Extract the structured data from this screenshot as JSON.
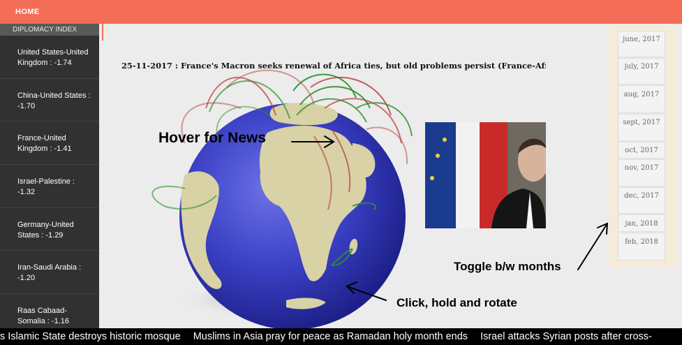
{
  "nav": {
    "home_label": "HOME"
  },
  "sidebar": {
    "title": "DIPLOMACY INDEX",
    "items": [
      {
        "label": "United States-United Kingdom : -1.74"
      },
      {
        "label": "China-United States : -1.70"
      },
      {
        "label": "France-United Kingdom : -1.41"
      },
      {
        "label": "Israel-Palestine : -1.32"
      },
      {
        "label": "Germany-United States : -1.29"
      },
      {
        "label": "Iran-Saudi Arabia : -1.20"
      },
      {
        "label": "Raas Cabaad-Somalia : -1.16"
      }
    ]
  },
  "news": {
    "headline": "25-11-2017 : France's Macron seeks renewal of Africa ties, but old problems persist (France-Afri"
  },
  "months": [
    {
      "label": "june, 2017"
    },
    {
      "label": "july, 2017"
    },
    {
      "label": "aug, 2017"
    },
    {
      "label": "sept, 2017"
    },
    {
      "label": "oct, 2017"
    },
    {
      "label": "nov, 2017"
    },
    {
      "label": "dec, 2017"
    },
    {
      "label": "jan, 2018"
    },
    {
      "label": "feb, 2018"
    }
  ],
  "annotations": {
    "hover": "Hover for News",
    "toggle": "Toggle b/w months",
    "rotate": "Click, hold and rotate"
  },
  "ticker": {
    "items": [
      "s Islamic State destroys historic mosque",
      "Muslims in Asia pray for peace as Ramadan holy month ends",
      "Israel attacks Syrian posts after cross-"
    ]
  },
  "colors": {
    "accent": "#f26c56",
    "sidebar_bg": "#313131",
    "globe_ocean": "#3a3fc4",
    "globe_land": "#d8d2a6",
    "arc_green": "#2f8f2a",
    "arc_red": "#b83a3a"
  }
}
